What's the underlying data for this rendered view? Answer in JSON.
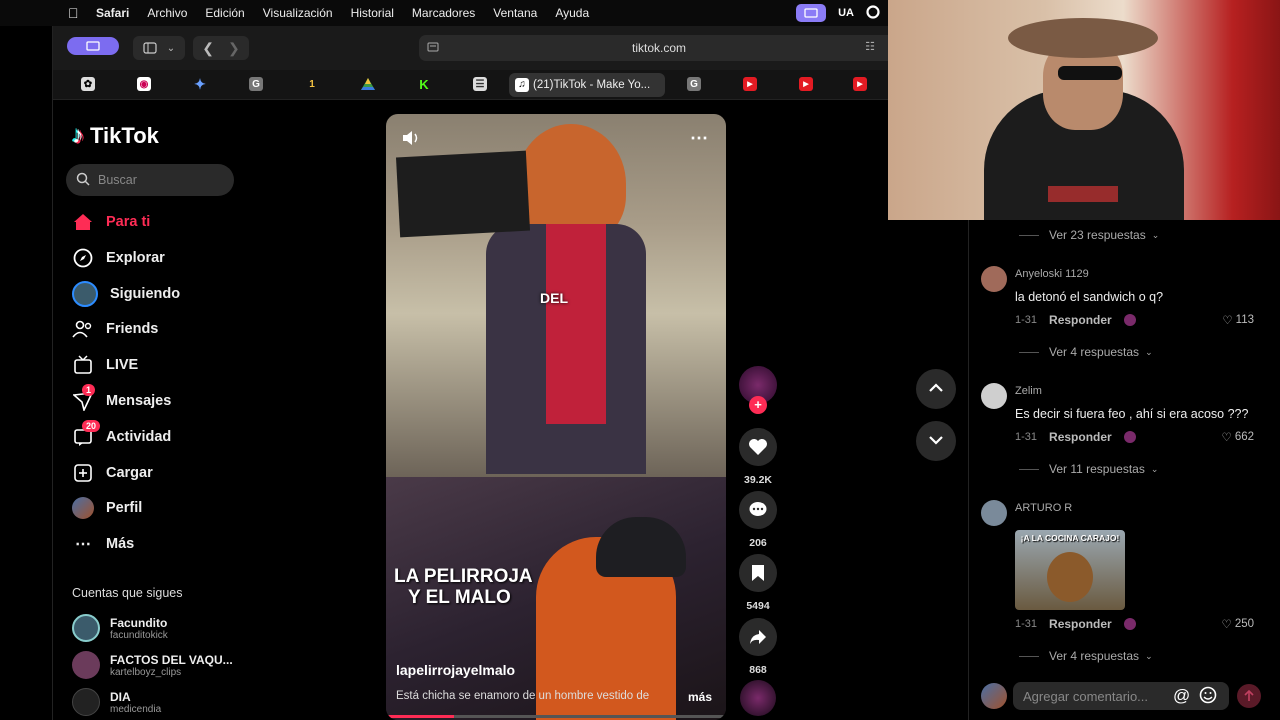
{
  "menubar": {
    "items": [
      "Safari",
      "Archivo",
      "Edición",
      "Visualización",
      "Historial",
      "Marcadores",
      "Ventana",
      "Ayuda"
    ],
    "input_lang": "UA"
  },
  "browser": {
    "url": "tiktok.com",
    "active_tab": "(21)TikTok - Make Yo...",
    "tab_icons": [
      "openai-icon",
      "screen-icon",
      "gemini-icon",
      "g-icon",
      "perplexity-icon",
      "drive-icon",
      "kick-icon",
      "notes-icon",
      "g-icon",
      "youtube-icon",
      "youtube-icon",
      "youtube-icon"
    ]
  },
  "sidebar": {
    "logo": "TikTok",
    "search_placeholder": "Buscar",
    "nav": [
      {
        "label": "Para ti",
        "icon": "home-icon",
        "active": true
      },
      {
        "label": "Explorar",
        "icon": "compass-icon"
      },
      {
        "label": "Siguiendo",
        "icon": "following-avatar-icon"
      },
      {
        "label": "Friends",
        "icon": "friends-icon"
      },
      {
        "label": "LIVE",
        "icon": "live-icon"
      },
      {
        "label": "Mensajes",
        "icon": "messages-icon",
        "badge": "1"
      },
      {
        "label": "Actividad",
        "icon": "activity-icon",
        "badge": "20"
      },
      {
        "label": "Cargar",
        "icon": "upload-icon"
      },
      {
        "label": "Perfil",
        "icon": "profile-avatar-icon"
      },
      {
        "label": "Más",
        "icon": "more-icon"
      }
    ],
    "following_title": "Cuentas que sigues",
    "following": [
      {
        "name": "Facundito",
        "handle": "facunditokick",
        "color": "#3b5b6b"
      },
      {
        "name": "FACTOS DEL VAQU...",
        "handle": "kartelboyz_clips",
        "color": "#6b3b5b"
      },
      {
        "name": "DIA",
        "handle": "medicendia",
        "color": "#222222"
      }
    ]
  },
  "video": {
    "caption_word": "DEL",
    "title_line1": "LA PELIRROJA",
    "title_line2": "Y EL MALO",
    "author": "lapelirrojayelmalo",
    "description": "Está chicha se enamoro de un hombre vestido de",
    "more": "más",
    "progress": 0.2
  },
  "actions": {
    "likes": "39.2K",
    "comments": "206",
    "saves": "5494",
    "shares": "868"
  },
  "comments": {
    "top_more": "Ver 23 respuestas",
    "items": [
      {
        "user": "Anyeloski 1129",
        "text": "la detonó el sandwich o q?",
        "date": "1-31",
        "reply": "Responder",
        "likes": "113",
        "more": "Ver 4 respuestas"
      },
      {
        "user": "Zelim",
        "text": "Es decir si fuera feo , ahí si era acoso ???",
        "date": "1-31",
        "reply": "Responder",
        "likes": "662",
        "more": "Ver 11 respuestas"
      },
      {
        "user": "ARTURO R",
        "sticker_text": "¡A LA COCINA CARAJO!",
        "date": "1-31",
        "reply": "Responder",
        "likes": "250",
        "more": "Ver 4 respuestas"
      }
    ],
    "input_placeholder": "Agregar comentario..."
  }
}
